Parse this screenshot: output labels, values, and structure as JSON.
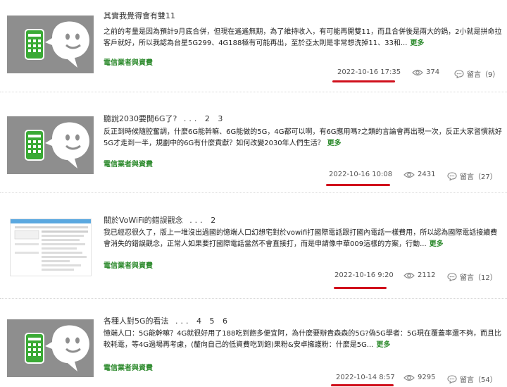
{
  "posts": [
    {
      "title": "其實我覺得會有雙11",
      "pages": [],
      "excerpt": "之前的考量是因為預計9月底合併，但現在遙遙無期，為了維持收入，有可能再開雙11，而且合併後是兩大的鍋，2小就是拼命拉客戶就好，所以我認為台星5G299、4G188極有可能再出，至於亞太則是非常想洗掉11、33和...",
      "more": "更多",
      "category": "電信業者與資費",
      "date": "2022-10-16 17:35",
      "views": "374",
      "comments": "留言（9）",
      "thumb": "phone-mascot"
    },
    {
      "title": "聽說2030要開6G了?",
      "pages": [
        "...",
        "2",
        "3"
      ],
      "excerpt": "反正到時候隨腔奮調，什麼6G能幹嘛、6G能做的5G，4G都可以啊，有6G應用嗎?之類的言論會再出現一次，反正大家習慣就好5G才走到一半，規劃中的6G有什麼貢獻？如何改變2030年人們生活？",
      "more": "更多",
      "category": "電信業者與資費",
      "date": "2022-10-16 10:08",
      "views": "2431",
      "comments": "留言（27）",
      "thumb": "phone-mascot"
    },
    {
      "title": "關於VoWiFi的錯誤觀念",
      "pages": [
        "...",
        "2"
      ],
      "excerpt": "我已經忍很久了，版上一堆沒出過國的憶端人口幻想宅對於vowifi打國際電話跟打國內電話一樣費用，所以認為國際電話接續費會消失的錯誤觀念，正常人如果要打國際電話當然不會直接打，而是申請像中華009這樣的方案，行動...",
      "more": "更多",
      "category": "電信業者與資費",
      "date": "2022-10-16 9:20",
      "views": "2112",
      "comments": "留言（12）",
      "thumb": "document"
    },
    {
      "title": "各種人對5G的看法",
      "pages": [
        "...",
        "4",
        "5",
        "6"
      ],
      "excerpt": "憶端人口：5G能幹嘛？4G就很好用了188吃到飽多便宜阿，為什麼要辦貴森森的5G?偽5G學者：5G現在覆蓋率還不夠，而且比較耗電，等4G過場再考慮，(釐向自己的低資費吃到飽)果粉&安卓擁護粉：什麼是5G...",
      "more": "更多",
      "category": "電信業者與資費",
      "date": "2022-10-14 8:57",
      "views": "9295",
      "comments": "留言（54）",
      "thumb": "phone-mascot"
    }
  ]
}
